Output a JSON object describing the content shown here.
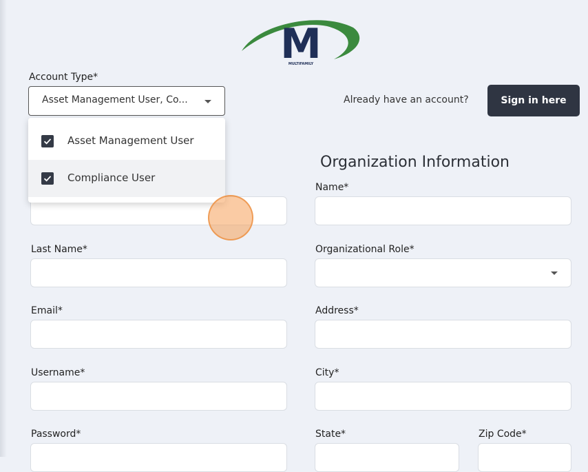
{
  "logo": {
    "letter": "M",
    "subtitle": "MULTIFAMILY"
  },
  "account_type": {
    "label": "Account Type*",
    "selected_text": "Asset Management User, Co...",
    "options": [
      {
        "label": "Asset Management User",
        "checked": true
      },
      {
        "label": "Compliance User",
        "checked": true
      }
    ]
  },
  "signin": {
    "prompt": "Already have an account?",
    "button": "Sign in here"
  },
  "personal": {
    "last_name_label": "Last Name*",
    "email_label": "Email*",
    "username_label": "Username*",
    "password_label": "Password*"
  },
  "organization": {
    "title": "Organization Information",
    "name_label": "Name*",
    "role_label": "Organizational Role*",
    "address_label": "Address*",
    "city_label": "City*",
    "state_label": "State*",
    "zip_label": "Zip Code*"
  },
  "colors": {
    "background": "#eef1f7",
    "button": "#2f3542",
    "logo_navy": "#1f2f57",
    "logo_green": "#3b8a3e",
    "cursor": "#f5a05a"
  }
}
